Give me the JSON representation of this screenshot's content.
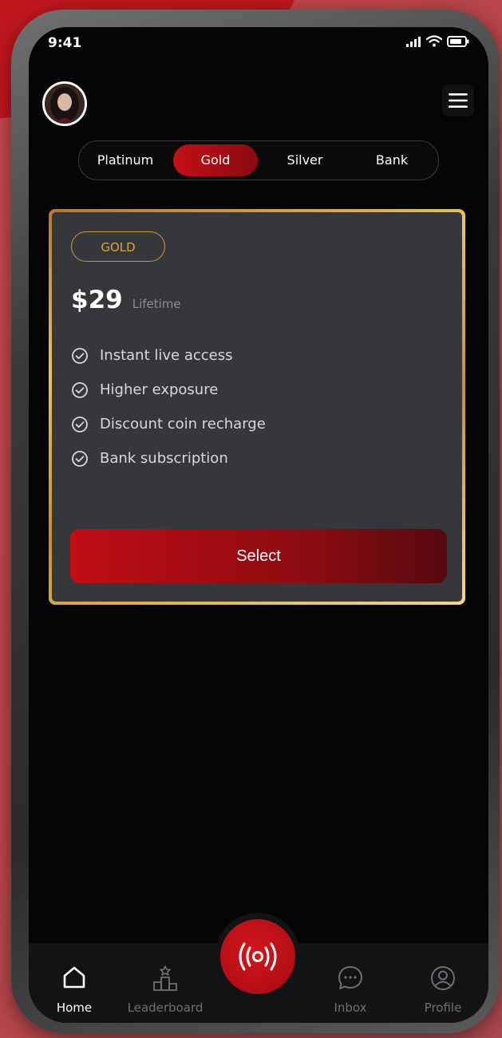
{
  "status_bar": {
    "time": "9:41"
  },
  "header": {
    "avatar_icon": "user-avatar",
    "menu_icon": "hamburger-menu-icon"
  },
  "tier_tabs": [
    {
      "label": "Platinum",
      "active": false
    },
    {
      "label": "Gold",
      "active": true
    },
    {
      "label": "Silver",
      "active": false
    },
    {
      "label": "Bank",
      "active": false
    }
  ],
  "plan": {
    "badge": "GOLD",
    "price": "$29",
    "term": "Lifetime",
    "features": [
      "Instant live access",
      "Higher exposure",
      "Discount coin recharge",
      "Bank subscription"
    ],
    "select_label": "Select"
  },
  "bottom_nav": {
    "items": [
      {
        "label": "Home",
        "icon": "home-icon",
        "active": true
      },
      {
        "label": "Leaderboard",
        "icon": "podium-icon",
        "active": false
      },
      {
        "label": "Inbox",
        "icon": "chat-bubble-icon",
        "active": false
      },
      {
        "label": "Profile",
        "icon": "user-circle-icon",
        "active": false
      }
    ],
    "center_icon": "live-broadcast-icon"
  },
  "colors": {
    "accent_red": "#c40f18",
    "gold": "#d7a84a",
    "card_bg": "#35373a",
    "screen_bg": "#050505"
  }
}
